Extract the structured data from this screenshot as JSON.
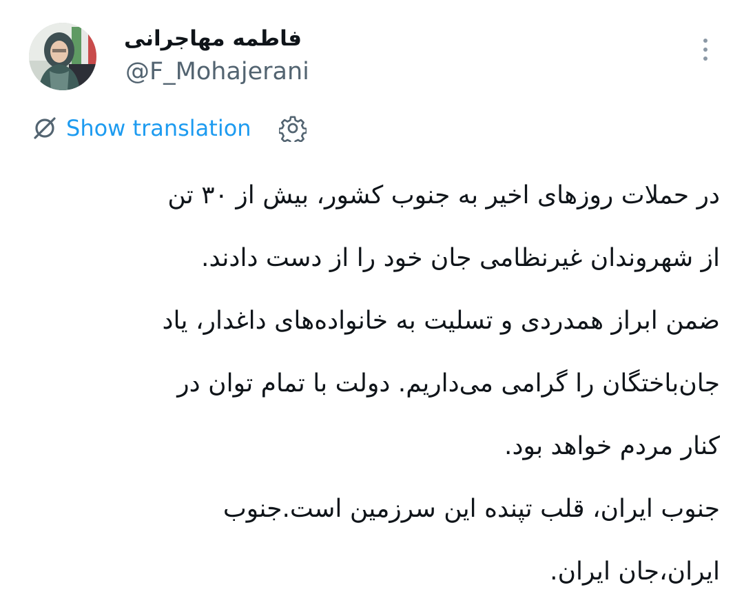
{
  "author": {
    "display_name": "فاطمه مهاجرانی",
    "handle": "@F_Mohajerani"
  },
  "icons": {
    "avatar": "profile-photo",
    "more": "more-vertical-icon",
    "translate": "translate-icon",
    "settings": "gear-icon"
  },
  "translation": {
    "show_label": "Show translation"
  },
  "colors": {
    "link": "#1d9bf0",
    "secondary_text": "#536471",
    "icon_gray": "#8b98a5",
    "text": "#0f1419"
  },
  "tweet": {
    "lines": [
      "در حملات روزهای اخیر به جنوب کشور، بیش از ۳۰ تن",
      "از شهروندان غیرنظامی جان خود را از دست دادند.",
      "ضمن ابراز همدردی و تسلیت به خانواده‌های داغدار، یاد",
      "جان‌باختگان را گرامی می‌داریم. دولت با تمام توان در",
      "کنار مردم خواهد بود.",
      "جنوب ایران، قلب تپنده این سرزمین است.جنوب",
      "ایران،جان ایران."
    ]
  }
}
